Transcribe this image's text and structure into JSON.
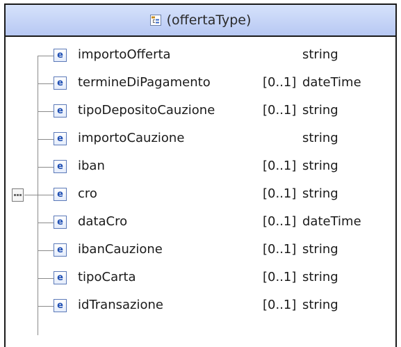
{
  "complex_type": {
    "title": "(offertaType)"
  },
  "elements": [
    {
      "icon": "e",
      "name": "importoOfferta",
      "occurs": "",
      "type": "string"
    },
    {
      "icon": "e",
      "name": "termineDiPagamento",
      "occurs": "[0..1]",
      "type": "dateTime"
    },
    {
      "icon": "e",
      "name": "tipoDepositoCauzione",
      "occurs": "[0..1]",
      "type": "string"
    },
    {
      "icon": "e",
      "name": "importoCauzione",
      "occurs": "",
      "type": "string"
    },
    {
      "icon": "e",
      "name": "iban",
      "occurs": "[0..1]",
      "type": "string"
    },
    {
      "icon": "e",
      "name": "cro",
      "occurs": "[0..1]",
      "type": "string"
    },
    {
      "icon": "e",
      "name": "dataCro",
      "occurs": "[0..1]",
      "type": "dateTime"
    },
    {
      "icon": "e",
      "name": "ibanCauzione",
      "occurs": "[0..1]",
      "type": "string"
    },
    {
      "icon": "e",
      "name": "tipoCarta",
      "occurs": "[0..1]",
      "type": "string"
    },
    {
      "icon": "e",
      "name": "idTransazione",
      "occurs": "[0..1]",
      "type": "string"
    }
  ],
  "icons": {
    "header": "complex-type-icon",
    "compositor": "sequence-compositor-icon",
    "element": "element-icon"
  }
}
